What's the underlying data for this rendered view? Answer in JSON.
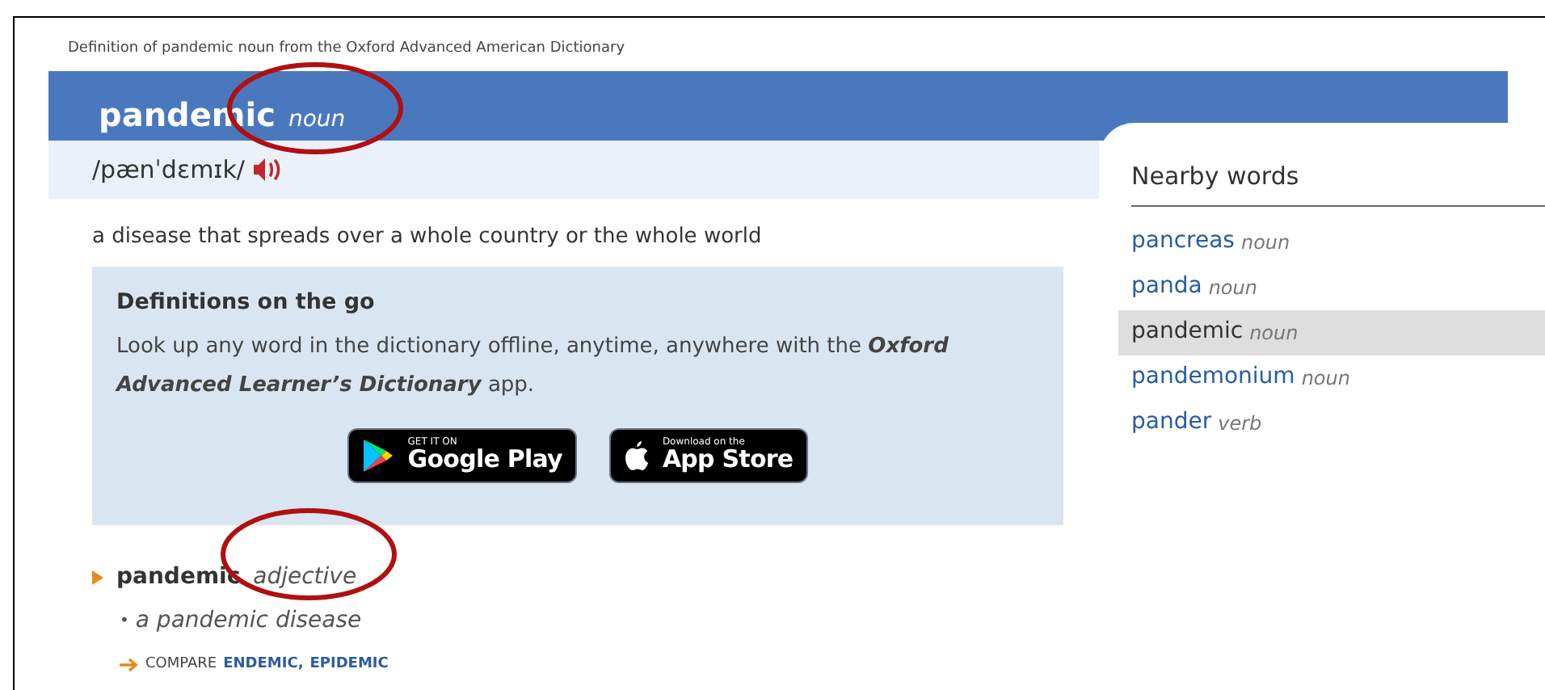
{
  "source_caption": "Definition of pandemic noun from the Oxford Advanced American Dictionary",
  "headword": {
    "word": "pandemic",
    "part_of_speech": "noun",
    "pronunciation": "/pænˈdɛmɪk/"
  },
  "definition": "a disease that spreads over a whole country or the whole world",
  "promo": {
    "title": "Definitions on the go",
    "text": "Look up any word in the dictionary offline, anytime, anywhere with the **Oxford Advanced Learner’s Dictionary** app.",
    "badges": [
      {
        "kind": "google",
        "small": "GET IT ON",
        "big": "Google Play"
      },
      {
        "kind": "apple",
        "small": "Download on the",
        "big": "App Store"
      }
    ]
  },
  "sense": {
    "word": "pandemic",
    "part_of_speech": "adjective",
    "bullet": "•",
    "example": "a pandemic disease",
    "compare_label": "COMPARE",
    "compare_links": [
      "ENDEMIC",
      "EPIDEMIC"
    ],
    "compare_separator": ","
  },
  "nearby": {
    "title": "Nearby words",
    "items": [
      {
        "word": "pancreas",
        "part_of_speech": "noun",
        "selected": false
      },
      {
        "word": "panda",
        "part_of_speech": "noun",
        "selected": false
      },
      {
        "word": "pandemic",
        "part_of_speech": "noun",
        "selected": true
      },
      {
        "word": "pandemonium",
        "part_of_speech": "noun",
        "selected": false
      },
      {
        "word": "pander",
        "part_of_speech": "verb",
        "selected": false
      }
    ]
  },
  "annotations": [
    {
      "kind": "ellipse"
    },
    {
      "kind": "ellipse"
    }
  ]
}
